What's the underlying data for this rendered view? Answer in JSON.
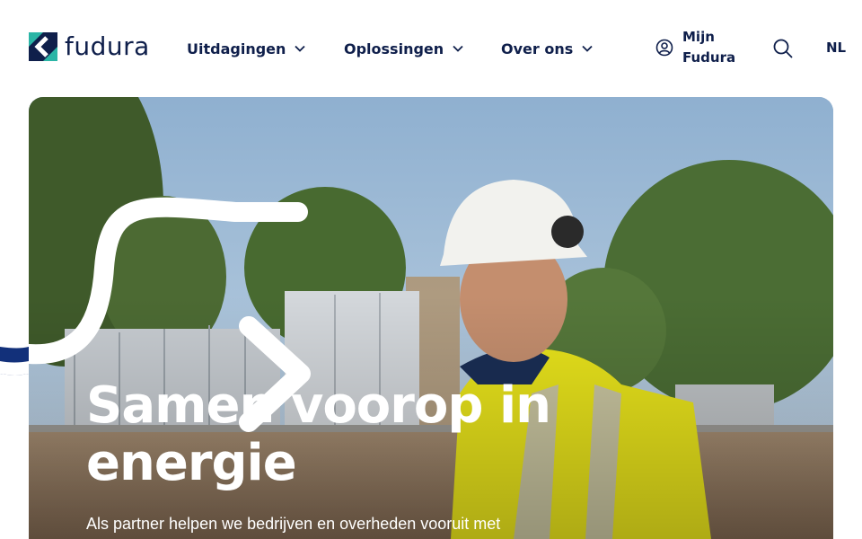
{
  "header": {
    "logo": {
      "text": "fudura",
      "icon": "fudura-logo-icon"
    },
    "nav": [
      {
        "label": "Uitdagingen",
        "icon": "chevron-down-icon"
      },
      {
        "label": "Oplossingen",
        "icon": "chevron-down-icon"
      },
      {
        "label": "Over ons",
        "icon": "chevron-down-icon"
      }
    ],
    "account": {
      "label": "Mijn\nFudura",
      "icon": "user-circle-icon"
    },
    "search": {
      "icon": "search-icon"
    },
    "language": "NL"
  },
  "hero": {
    "title": "Samen voorop in energie",
    "subtitle": "Als partner helpen we bedrijven en overheden vooruit met",
    "photo": "worker-in-hard-hat-and-hi-vis-jacket-in-front-of-electrical-cabinets",
    "decoration": "white-curved-arrow"
  },
  "colors": {
    "brand_navy": "#0f1f4b",
    "brand_teal": "#2bb5a6",
    "arrow": "#ffffff",
    "arrow_accent": "#12307a"
  }
}
